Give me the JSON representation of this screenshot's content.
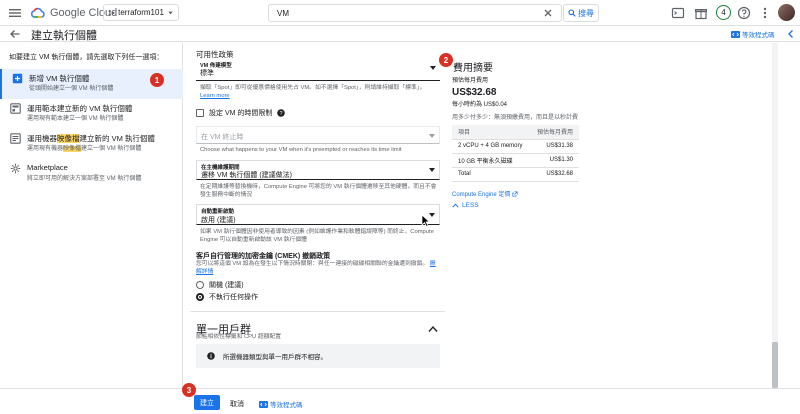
{
  "topbar": {
    "logo_text": "Google Cloud",
    "project": "terraform101",
    "search_value": "VM",
    "search_button": "搜尋",
    "notification_count": "4"
  },
  "header": {
    "title": "建立執行個體",
    "equivalent_code": "等效程式碼"
  },
  "left": {
    "heading": "如要建立 VM 執行個體，請先選取下列任一選項：",
    "options": [
      {
        "title": "新增 VM 執行個體",
        "sub": "從頭開始建立一個 VM 執行個體"
      },
      {
        "title": "運用範本建立新的 VM 執行個體",
        "sub": "運用現有範本建立一個 VM 執行個體"
      },
      {
        "title_pre": "運用機器",
        "title_hl": "映像檔",
        "title_post": "建立新的 VM 執行個體",
        "sub_pre": "運用現有機器",
        "sub_hl": "映像檔",
        "sub_post": "建立一個 VM 執行個體"
      },
      {
        "title": "Marketplace",
        "sub": "將立即可用的解決方案部署至 VM 執行個體"
      }
    ]
  },
  "form": {
    "availability_title": "可用性政策",
    "provisioning_label": "VM 佈建模型",
    "provisioning_value": "標準",
    "provisioning_help": "擷取「Spot」即可從優惠價格使用先占 VM。如不選擇「Spot」，則請維持擷取「標準」。",
    "learn_more": "Learn more",
    "time_limit_label": "設定 VM 的時間限制",
    "on_termination_placeholder": "在 VM 終止時",
    "on_termination_help": "Choose what happens to your VM when it's preempted or reaches its time limit",
    "maintenance_label": "在主機維護期間",
    "maintenance_value": "遷移 VM 執行個體 (建議做法)",
    "maintenance_help": "在定期維護等替換機時，Compute Engine 可將您的 VM 執行個體遷移至其他硬體，而且不會發生服務中斷的情況",
    "restart_label": "自動重新啟動",
    "restart_value": "啟用 (建議)",
    "restart_help": "如果 VM 執行個體因非使用者導致的因素 (例如維護作業和軟體錯誤障等) 而終止，Compute Engine 可以自動重新啟動該 VM 執行個體",
    "cmek_title": "客戶自行管理的加密金鑰 (CMEK) 撤銷政策",
    "cmek_help": "您可以將這個 VM 設為在發生以下情況時關閉：與任一連接的磁碟相關聯的金鑰遭到撤銷。",
    "cmek_link": "瞭解詳情",
    "radio_off": "關機 (建議)",
    "radio_noop": "不執行任何操作",
    "sole_title": "單一用戶群",
    "sole_sub": "節點相依性標籤和 CPU 超額配置",
    "sole_info": "所選機器類型與單一用戶群不相容。"
  },
  "summary": {
    "title": "費用摘要",
    "monthly_label": "預估每月費用",
    "monthly_value": "US$32.68",
    "hourly": "每小時約為 US$0.04",
    "usage_note": "用多少付多少：無須預繳費用，而且是以秒計費",
    "table_header_item": "項目",
    "table_header_cost": "預估每月費用",
    "rows": [
      {
        "item": "2 vCPU + 4 GB memory",
        "cost": "US$31.38"
      },
      {
        "item": "10 GB 平衡永久磁碟",
        "cost": "US$1.30"
      },
      {
        "item": "Total",
        "cost": "US$32.68"
      }
    ],
    "pricing_link": "Compute Engine 定價",
    "less": "LESS"
  },
  "bottom": {
    "create": "建立",
    "cancel": "取消",
    "equivalent_code": "等效程式碼"
  },
  "markers": [
    "1",
    "2",
    "3"
  ],
  "colors": {
    "accent": "#1a73e8",
    "marker": "#d93025",
    "highlight": "#fdd663"
  }
}
